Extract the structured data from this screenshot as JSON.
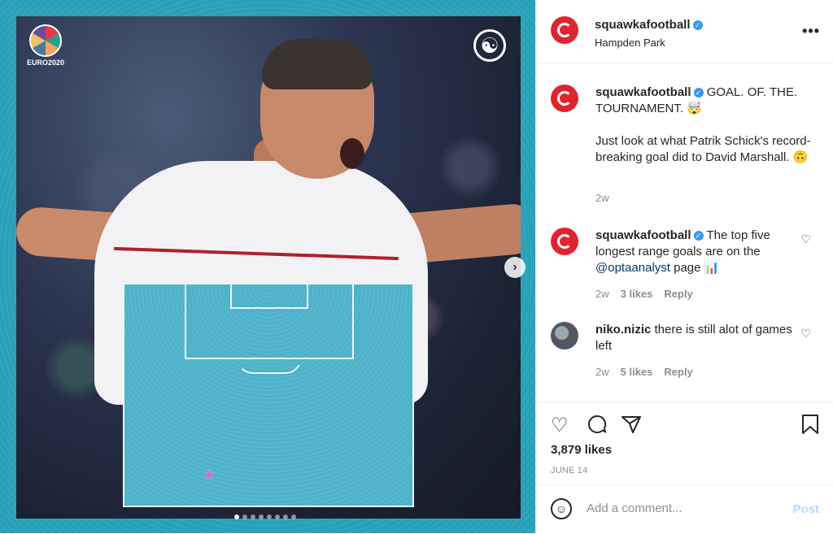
{
  "post": {
    "account": "squawkafootball",
    "location": "Hampden Park",
    "image": {
      "euro_logo_text": "EURO2020",
      "carousel_dots": 8,
      "active_dot": 0
    }
  },
  "icons": {
    "more": "more-options-icon",
    "verified": "verified-badge-icon",
    "heart": "heart-icon",
    "comment": "comment-icon",
    "share": "share-icon",
    "bookmark": "bookmark-icon",
    "emoji": "emoji-icon",
    "next": "chevron-right-icon"
  },
  "comments": [
    {
      "user": "squawkafootball",
      "text": "GOAL. OF. THE. TOURNAMENT. 🤯",
      "text2": "Just look at what Patrik Schick's record-breaking goal did to David Marshall. 🙃",
      "time": "2w"
    },
    {
      "user": "squawkafootball",
      "text_before": "The top five longest range goals are on the ",
      "mention": "@optaanalyst",
      "text_after": " page 📊",
      "time": "2w",
      "likes": "3 likes",
      "reply": "Reply"
    },
    {
      "user": "niko.nizic",
      "text": "there is still alot of games left",
      "time": "2w",
      "likes": "5 likes",
      "reply": "Reply"
    }
  ],
  "engagement": {
    "likes": "3,879 likes",
    "date": "JUNE 14"
  },
  "add_comment": {
    "placeholder": "Add a comment...",
    "post_label": "Post"
  },
  "colors": {
    "brand_red": "#e0232c",
    "teal": "#2a9fb8",
    "link": "#00376b",
    "post_disabled": "#b3dbff"
  }
}
